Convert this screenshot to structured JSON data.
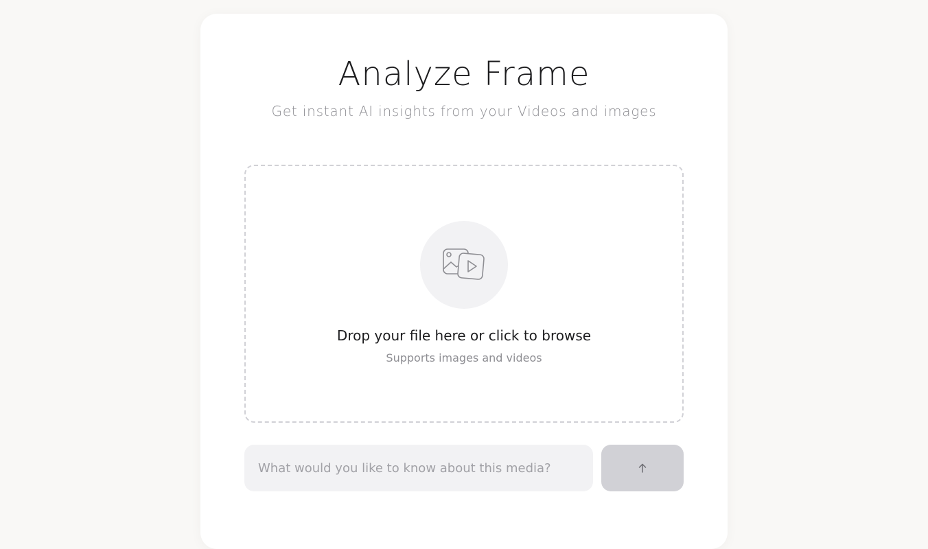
{
  "header": {
    "title": "Analyze Frame",
    "subtitle": "Get instant AI insights from your Videos and images"
  },
  "dropzone": {
    "icon": "image-video-icon",
    "prompt": "Drop your file here or click to browse",
    "supported": "Supports images and videos"
  },
  "query": {
    "value": "",
    "placeholder": "What would you like to know about this media?"
  },
  "send": {
    "icon": "arrow-up-icon",
    "state": "disabled"
  },
  "colors": {
    "page_background": "#f9f8f6",
    "card_background": "#ffffff",
    "input_background": "#f2f2f4",
    "button_disabled": "#d1d1d6",
    "text_primary": "#1c1c1e",
    "text_secondary": "#8e8e93"
  }
}
